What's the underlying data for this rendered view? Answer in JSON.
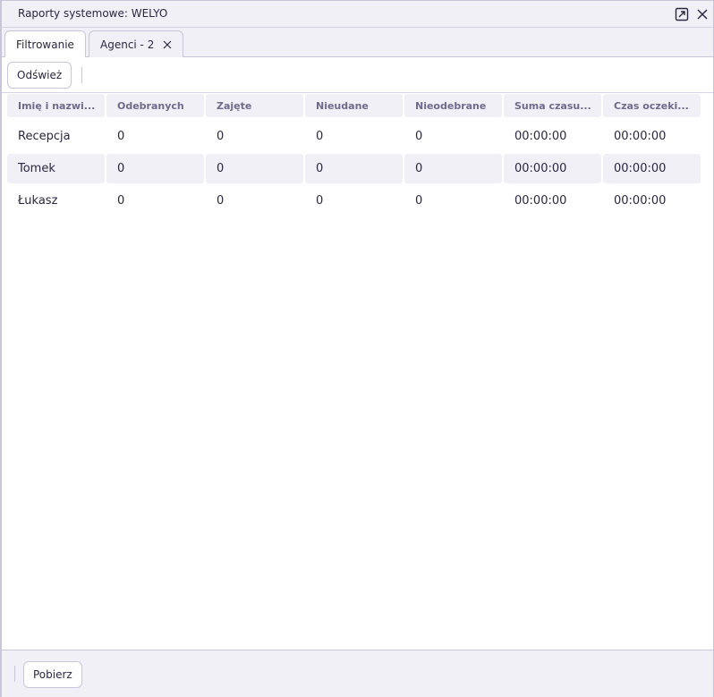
{
  "window": {
    "title": "Raporty systemowe: WELYO",
    "popout_icon": "popout-icon",
    "close_icon": "close-icon"
  },
  "tabs": [
    {
      "label": "Filtrowanie",
      "active": true
    },
    {
      "label": "Agenci - 2",
      "active": false,
      "closable": true
    }
  ],
  "toolbar": {
    "refresh_label": "Odśwież"
  },
  "table": {
    "columns": [
      "Imię i nazwi...",
      "Odebranych",
      "Zajęte",
      "Nieudane",
      "Nieodebrane",
      "Suma czasu...",
      "Czas oczeki..."
    ],
    "rows": [
      [
        "Recepcja",
        "0",
        "0",
        "0",
        "0",
        "00:00:00",
        "00:00:00"
      ],
      [
        "Tomek",
        "0",
        "0",
        "0",
        "0",
        "00:00:00",
        "00:00:00"
      ],
      [
        "Łukasz",
        "0",
        "0",
        "0",
        "0",
        "00:00:00",
        "00:00:00"
      ]
    ]
  },
  "footer": {
    "download_label": "Pobierz"
  },
  "colors": {
    "panel": "#f1f0f7",
    "border": "#c9c6dc",
    "text": "#2a2740",
    "header_text": "#6f6a8c"
  }
}
